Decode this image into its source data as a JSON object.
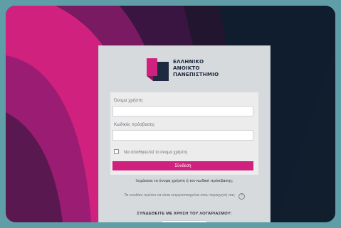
{
  "brand": {
    "line1": "ΕΛΛΗΝΙΚΟ",
    "line2": "ΑΝΟΙΚΤΟ",
    "line3": "ΠΑΝΕΠΙΣΤΗΜΙΟ",
    "logo_color": "#d1217e",
    "logo_dark": "#1e2a40"
  },
  "form": {
    "username_label": "Όνομα χρήστη",
    "username_value": "",
    "password_label": "Κωδικός πρόσβασης",
    "password_value": "",
    "remember_label": "Να αποθηκευτεί το όνομα χρήστη",
    "login_label": "Σύνδεση"
  },
  "links": {
    "forgot": "Ξεχάσατε το όνομα χρήστη ή τον κωδικό πρόσβασης;",
    "cookies": "Τα cookies πρέπει να είναι ενεργοποιημένα στον περιηγητή σας"
  },
  "account": {
    "heading": "ΣΥΝΔΕΘΕΙΤΕ ΜΕ ΧΡΗΣΗ ΤΟΥ ΛΟΓΑΡΙΑΣΜΟΥ:"
  },
  "colors": {
    "accent": "#d1217e",
    "outer_bg": "#5f9ea6",
    "dark_bg": "#0f1d2f"
  }
}
